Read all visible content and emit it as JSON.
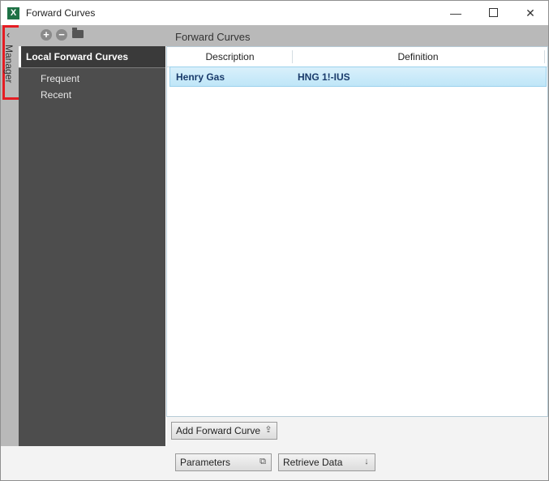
{
  "window": {
    "title": "Forward Curves",
    "app_icon": "excel-icon",
    "minimize_glyph": "—",
    "close_glyph": "✕"
  },
  "collapsed_panel": {
    "label": "Manager",
    "collapse_glyph": "‹",
    "highlight_color": "#e51c23"
  },
  "toolbar": {
    "add_glyph": "+",
    "remove_glyph": "−",
    "panel_title": "Forward Curves"
  },
  "sidebar": {
    "header": "Local Forward Curves",
    "items": [
      {
        "label": "Frequent"
      },
      {
        "label": "Recent"
      }
    ]
  },
  "grid": {
    "columns": [
      "Description",
      "Definition"
    ],
    "rows": [
      {
        "description": "Henry Gas",
        "definition": "HNG 1!-IUS",
        "selected": true
      }
    ]
  },
  "buttons": {
    "add_forward_curve": "Add Forward Curve",
    "parameters": "Parameters",
    "retrieve_data": "Retrieve Data"
  },
  "colors": {
    "sidebar_bg": "#4d4d4d",
    "selected_row": "#bfe6f8",
    "row_text": "#1a3b6b"
  }
}
